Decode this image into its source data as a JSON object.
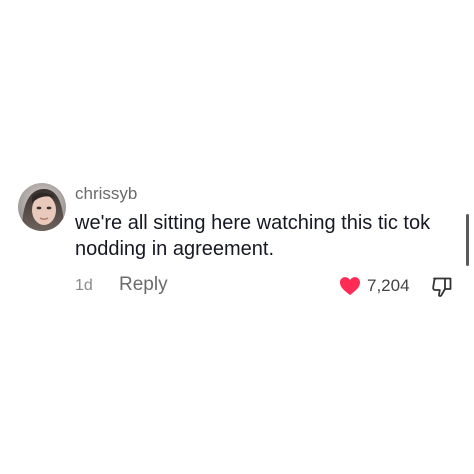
{
  "comment": {
    "username": "chrissyb",
    "text": "we're all sitting here watching this tic tok nodding in agreement.",
    "time_ago": "1d",
    "reply_label": "Reply",
    "like_count": "7,204",
    "liked": true
  },
  "colors": {
    "heart": "#fe2c55",
    "text": "#161823",
    "muted": "#6b6b6b"
  },
  "icons": {
    "like": "heart-icon",
    "dislike": "thumbs-down-icon",
    "avatar": "profile-photo"
  }
}
